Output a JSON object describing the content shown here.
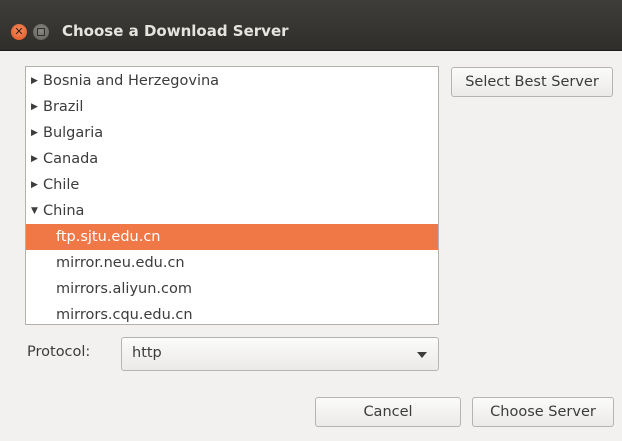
{
  "window": {
    "title": "Choose a Download Server"
  },
  "tree": {
    "rows": [
      {
        "label": "Bosnia and Herzegovina",
        "expanded": false
      },
      {
        "label": "Brazil",
        "expanded": false
      },
      {
        "label": "Bulgaria",
        "expanded": false
      },
      {
        "label": "Canada",
        "expanded": false
      },
      {
        "label": "Chile",
        "expanded": false
      },
      {
        "label": "China",
        "expanded": true
      },
      {
        "label": "ftp.sjtu.edu.cn",
        "selected": true
      },
      {
        "label": "mirror.neu.edu.cn"
      },
      {
        "label": "mirrors.aliyun.com"
      },
      {
        "label": "mirrors.cqu.edu.cn"
      }
    ],
    "collapsed_glyph": "▶",
    "expanded_glyph": "▼"
  },
  "buttons": {
    "select_best": "Select Best Server",
    "cancel": "Cancel",
    "choose": "Choose Server"
  },
  "protocol": {
    "label": "Protocol:",
    "value": "http"
  },
  "colors": {
    "selection": "#f07746",
    "titlebar": "#3a3935",
    "close": "#e95420"
  }
}
